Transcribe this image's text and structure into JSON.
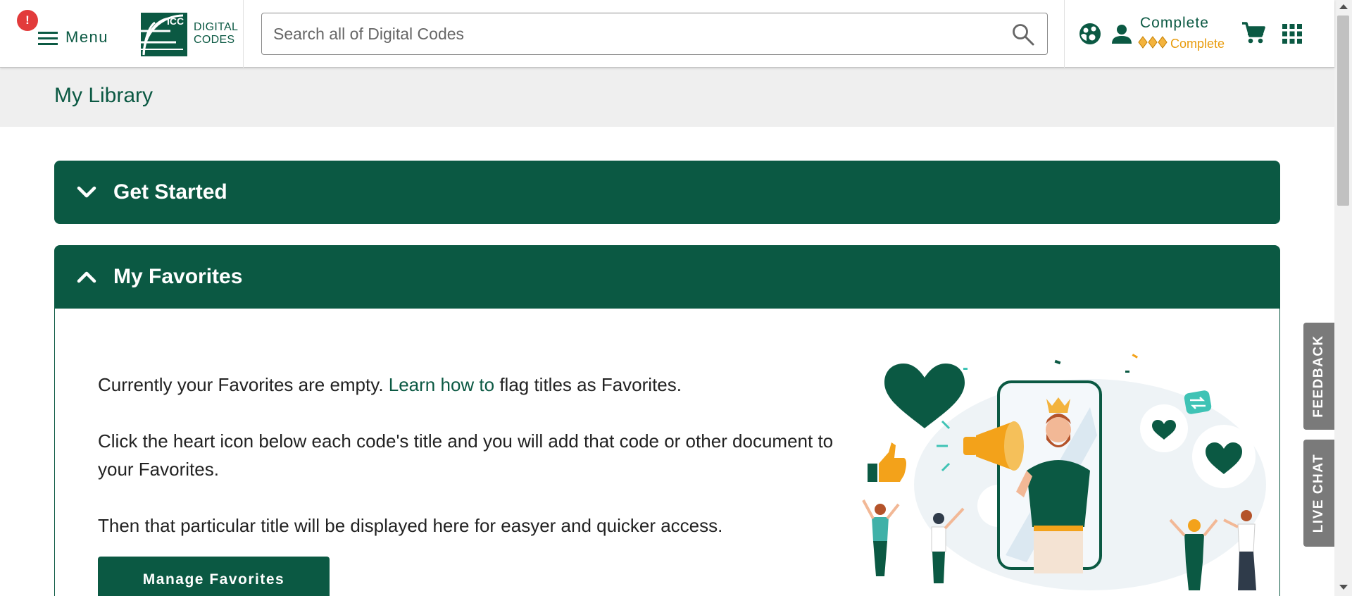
{
  "header": {
    "menu_badge": "!",
    "menu_label": "Menu",
    "logo_icc": "ICC",
    "logo_line1": "DIGITAL",
    "logo_line2": "CODES",
    "search_placeholder": "Search all of Digital Codes",
    "account_name": "Complete",
    "account_tier": "Complete",
    "icons": [
      "menu-icon",
      "search-icon",
      "community-icon",
      "user-icon",
      "cart-icon",
      "apps-grid-icon"
    ]
  },
  "library": {
    "title": "My Library"
  },
  "panels": {
    "get_started": {
      "title": "Get Started",
      "state": "collapsed"
    },
    "favorites": {
      "title": "My Favorites",
      "state": "expanded",
      "line1_before": "Currently your Favorites are empty. ",
      "line1_link": "Learn how to",
      "line1_after": " flag titles as Favorites.",
      "line2": "Click the heart icon below each code's title and you will add that code or other document to your Favorites.",
      "line3": "Then that particular title will be displayed here for easyer and quicker access.",
      "button_label": "Manage Favorites"
    }
  },
  "side_tabs": {
    "feedback": "FEEDBACK",
    "live_chat": "LIVE CHAT"
  },
  "colors": {
    "brand": "#0b5943",
    "accent": "#e89b0c",
    "badge": "#e23b3b",
    "side_tab": "#7a7a7a"
  }
}
